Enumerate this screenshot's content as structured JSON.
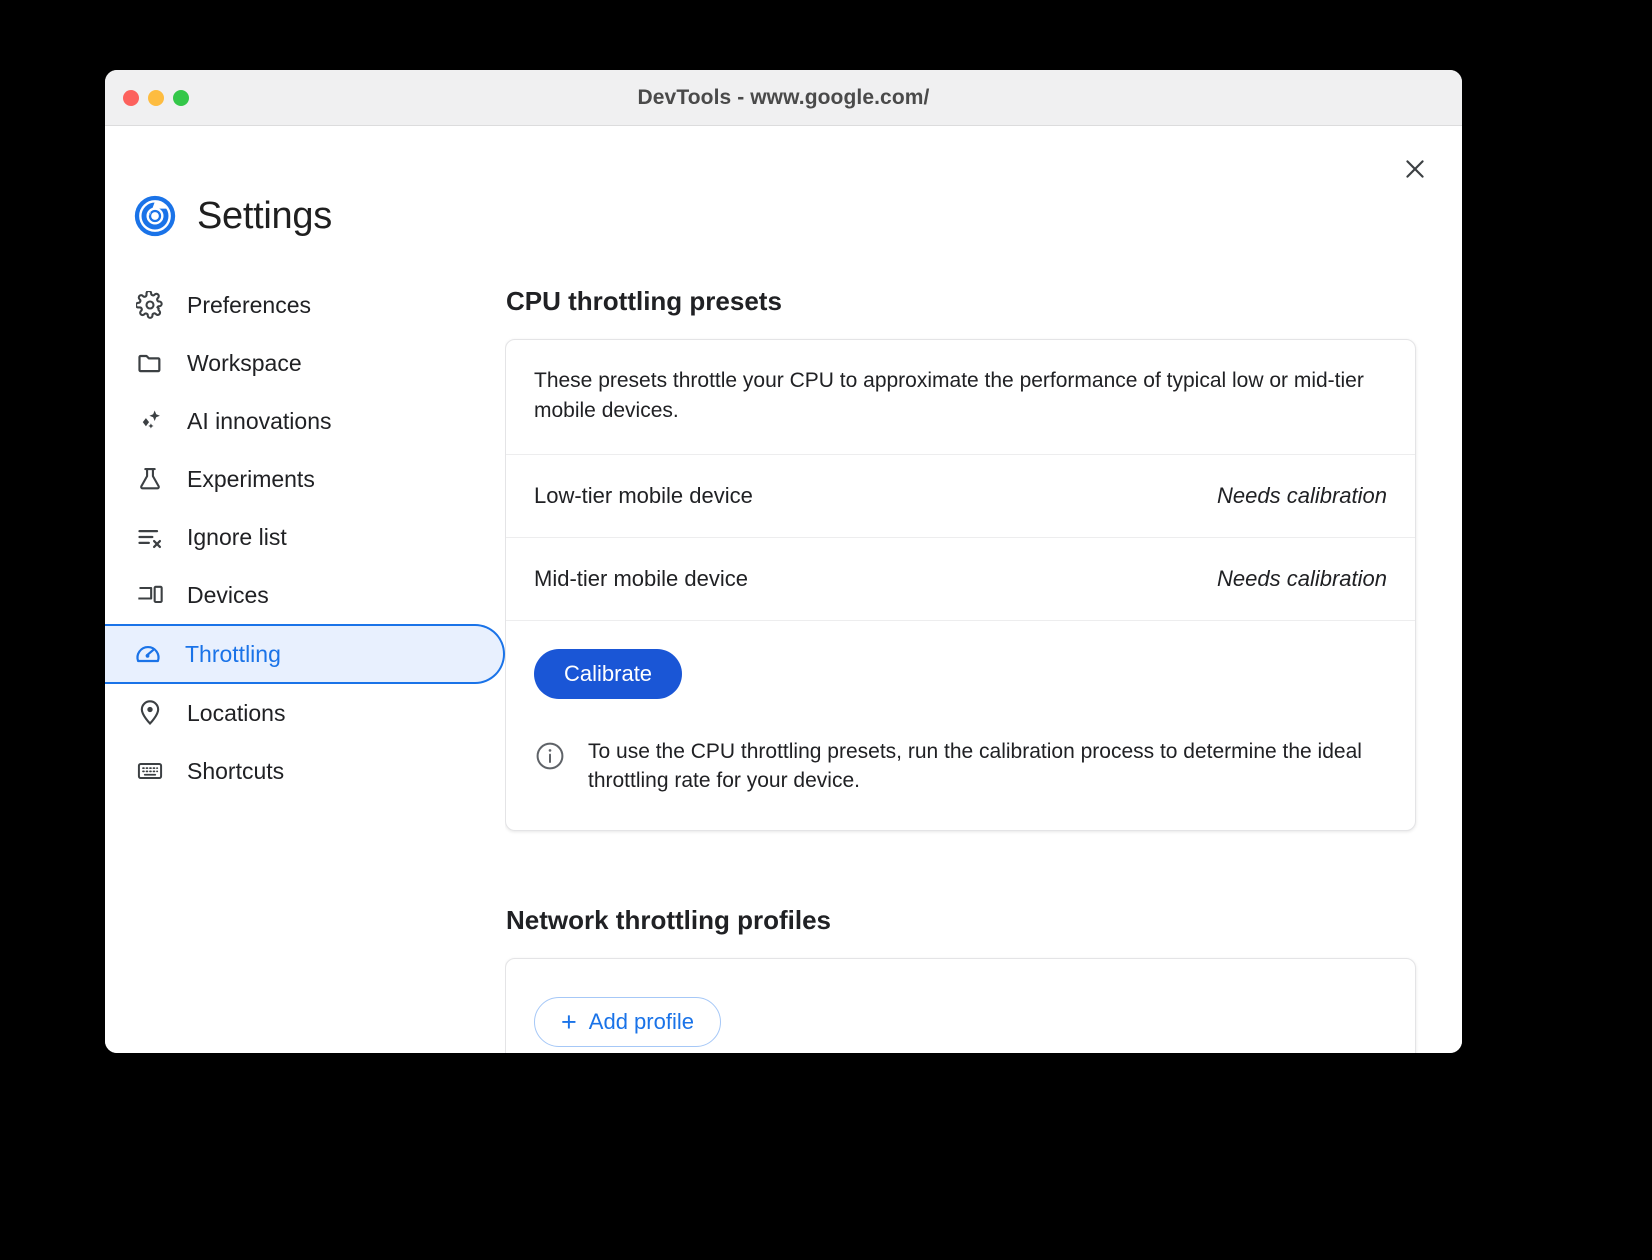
{
  "window": {
    "title": "DevTools - www.google.com/",
    "traffic_lights": [
      "close",
      "minimize",
      "zoom"
    ],
    "close_icon": "close-icon"
  },
  "sidebar": {
    "logo_icon": "devtools-chrome-logo-icon",
    "title": "Settings",
    "items": [
      {
        "label": "Preferences",
        "icon": "gear-icon",
        "selected": false
      },
      {
        "label": "Workspace",
        "icon": "folder-icon",
        "selected": false
      },
      {
        "label": "AI innovations",
        "icon": "sparkle-icon",
        "selected": false
      },
      {
        "label": "Experiments",
        "icon": "flask-icon",
        "selected": false
      },
      {
        "label": "Ignore list",
        "icon": "list-x-icon",
        "selected": false
      },
      {
        "label": "Devices",
        "icon": "devices-icon",
        "selected": false
      },
      {
        "label": "Throttling",
        "icon": "speedometer-icon",
        "selected": true
      },
      {
        "label": "Locations",
        "icon": "map-pin-icon",
        "selected": false
      },
      {
        "label": "Shortcuts",
        "icon": "keyboard-icon",
        "selected": false
      }
    ]
  },
  "main": {
    "cpu_section": {
      "title": "CPU throttling presets",
      "description": "These presets throttle your CPU to approximate the performance of typical low or mid-tier mobile devices.",
      "presets": [
        {
          "name": "Low-tier mobile device",
          "status": "Needs calibration"
        },
        {
          "name": "Mid-tier mobile device",
          "status": "Needs calibration"
        }
      ],
      "calibrate_label": "Calibrate",
      "info_icon": "info-circle-icon",
      "info_text": "To use the CPU throttling presets, run the calibration process to determine the ideal throttling rate for your device."
    },
    "network_section": {
      "title": "Network throttling profiles",
      "add_profile_label": "Add profile",
      "add_profile_icon": "plus-icon"
    }
  },
  "colors": {
    "accent_blue": "#1a73e8",
    "button_blue": "#1a56d6",
    "selected_bg": "#e8f0fe",
    "text_primary": "#202124"
  }
}
